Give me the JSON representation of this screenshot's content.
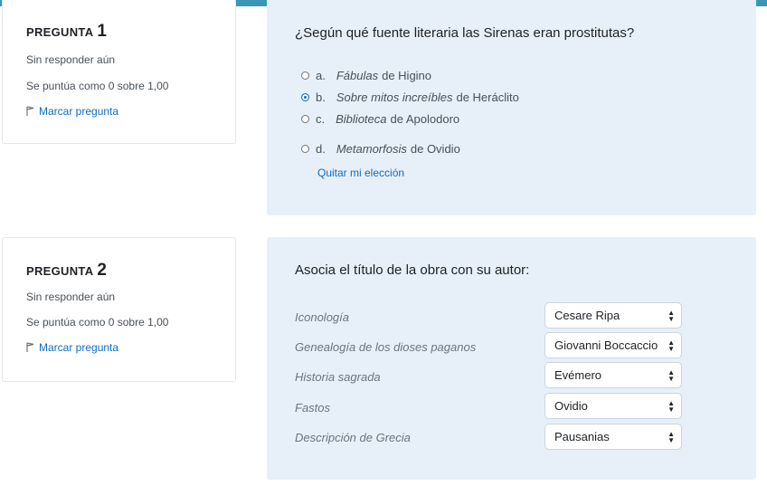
{
  "q1": {
    "heading": "PREGUNTA",
    "number": "1",
    "status": "Sin responder aún",
    "score": "Se puntúa como 0 sobre 1,00",
    "flag_label": "Marcar pregunta",
    "text": "¿Según qué fuente literaria las Sirenas eran prostitutas?",
    "options": [
      {
        "letter": "a.",
        "title": "Fábulas",
        "rest": "de Higino",
        "selected": false
      },
      {
        "letter": "b.",
        "title": "Sobre mitos increíbles",
        "rest": "de Heráclito",
        "selected": true
      },
      {
        "letter": "c.",
        "title": "Biblioteca",
        "rest": "de Apolodoro",
        "selected": false
      },
      {
        "letter": "d.",
        "title": "Metamorfosis",
        "rest": "de Ovidio",
        "selected": false
      }
    ],
    "clear_label": "Quitar mi elección"
  },
  "q2": {
    "heading": "PREGUNTA",
    "number": "2",
    "status": "Sin responder aún",
    "score": "Se puntúa como 0 sobre 1,00",
    "flag_label": "Marcar pregunta",
    "text": "Asocia el título de la obra con su autor:",
    "rows": [
      {
        "label": "Iconología",
        "value": "Cesare Ripa"
      },
      {
        "label": "Genealogía de los dioses paganos",
        "value": "Giovanni Boccaccio"
      },
      {
        "label": "Historia sagrada",
        "value": "Evémero"
      },
      {
        "label": "Fastos",
        "value": "Ovidio"
      },
      {
        "label": "Descripción de Grecia",
        "value": "Pausanias"
      }
    ]
  },
  "colors": {
    "accent": "#0f6cbf",
    "panel": "#e7f0f8",
    "topbar": "#3a97b5"
  }
}
